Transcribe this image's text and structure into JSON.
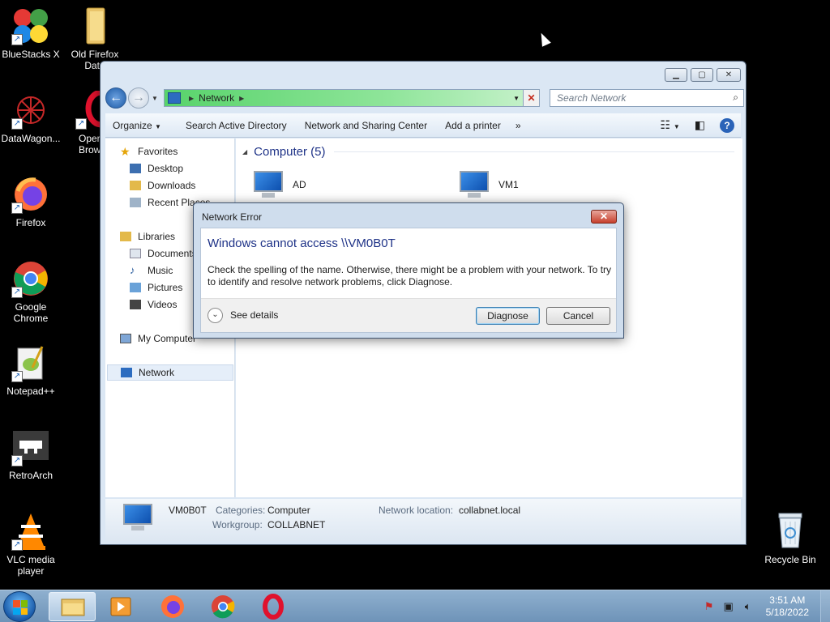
{
  "desktop": {
    "icons": [
      {
        "label": "BlueStacks X",
        "icon": "bluestacks-icon"
      },
      {
        "label": "Old Firefox Data",
        "icon": "folder-icon"
      },
      {
        "label": "DataWagon...",
        "icon": "datawagon-icon"
      },
      {
        "label": "Opera Browser",
        "icon": "opera-icon"
      },
      {
        "label": "Firefox",
        "icon": "firefox-icon"
      },
      {
        "label": "Google Chrome",
        "icon": "chrome-icon"
      },
      {
        "label": "Notepad++",
        "icon": "notepadpp-icon"
      },
      {
        "label": "RetroArch",
        "icon": "retroarch-icon"
      },
      {
        "label": "VLC media player",
        "icon": "vlc-icon"
      },
      {
        "label": "Recycle Bin",
        "icon": "recycle-bin-icon"
      }
    ]
  },
  "explorer": {
    "address": {
      "crumb": "Network"
    },
    "search": {
      "placeholder": "Search Network"
    },
    "toolbar": {
      "organize": "Organize",
      "search_ad": "Search Active Directory",
      "sharing_center": "Network and Sharing Center",
      "add_printer": "Add a printer",
      "more": "»"
    },
    "nav": {
      "favorites": "Favorites",
      "desktop": "Desktop",
      "downloads": "Downloads",
      "recent": "Recent Places",
      "libraries": "Libraries",
      "documents": "Documents",
      "music": "Music",
      "pictures": "Pictures",
      "videos": "Videos",
      "my_computer": "My Computer",
      "network": "Network"
    },
    "content": {
      "group": "Computer (5)",
      "items": [
        "AD",
        "VM1"
      ]
    },
    "details": {
      "name": "VM0B0T",
      "categories_label": "Categories:",
      "categories_value": "Computer",
      "workgroup_label": "Workgroup:",
      "workgroup_value": "COLLABNET",
      "location_label": "Network location:",
      "location_value": "collabnet.local"
    }
  },
  "dialog": {
    "title": "Network Error",
    "heading": "Windows cannot access \\\\VM0B0T",
    "message": "Check the spelling of the name. Otherwise, there might be a problem with your network. To try to identify and resolve network problems, click Diagnose.",
    "see_details": "See details",
    "diagnose": "Diagnose",
    "cancel": "Cancel"
  },
  "taskbar": {
    "time": "3:51 AM",
    "date": "5/18/2022"
  },
  "colors": {
    "accent_heading": "#1e3287",
    "address_green": "#58d36b",
    "taskbar": "#7d9fc3"
  }
}
